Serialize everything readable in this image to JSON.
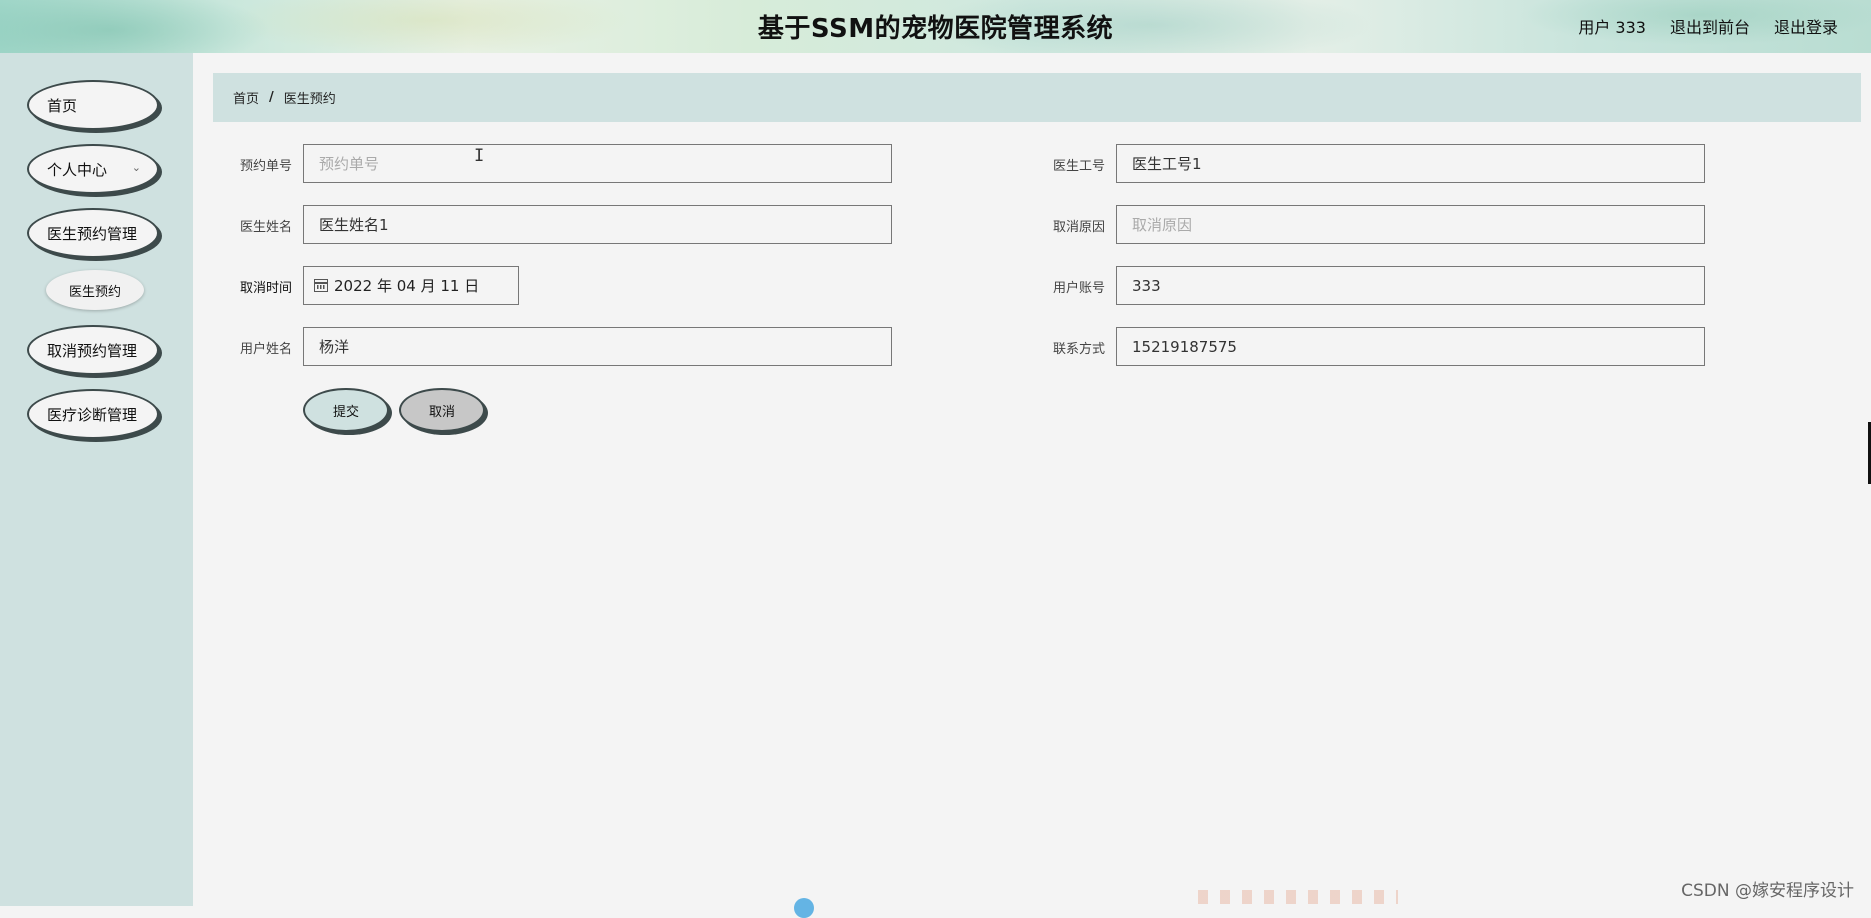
{
  "header": {
    "title": "基于SSM的宠物医院管理系统",
    "user_label": "用户 333",
    "back_to_front": "退出到前台",
    "logout": "退出登录"
  },
  "sidebar": {
    "items": [
      {
        "label": "首页"
      },
      {
        "label": "个人中心"
      },
      {
        "label": "医生预约管理"
      },
      {
        "label": "取消预约管理"
      },
      {
        "label": "医疗诊断管理"
      }
    ],
    "sub_item": "医生预约"
  },
  "breadcrumb": {
    "home": "首页",
    "separator": "/",
    "current": "医生预约"
  },
  "form": {
    "booking_no": {
      "label": "预约单号",
      "value": "",
      "placeholder": "预约单号"
    },
    "doctor_id": {
      "label": "医生工号",
      "value": "医生工号1"
    },
    "doctor_name": {
      "label": "医生姓名",
      "value": "医生姓名1"
    },
    "cancel_reason": {
      "label": "取消原因",
      "value": "",
      "placeholder": "取消原因"
    },
    "cancel_time": {
      "label": "取消时间",
      "value": "2022 年 04 月 11 日"
    },
    "user_account": {
      "label": "用户账号",
      "value": "333"
    },
    "user_name": {
      "label": "用户姓名",
      "value": "杨洋"
    },
    "contact": {
      "label": "联系方式",
      "value": "15219187575"
    },
    "submit": "提交",
    "cancel": "取消"
  },
  "watermark": "CSDN @嫁安程序设计",
  "icons": [
    "chevron-down-icon",
    "calendar-icon",
    "text-cursor-icon"
  ],
  "colors": {
    "sidebar_bg": "#cfe1e0",
    "page_bg": "#f4f4f4",
    "pill_border": "#3d4a4b",
    "cancel_button": "#c7c7c7"
  }
}
